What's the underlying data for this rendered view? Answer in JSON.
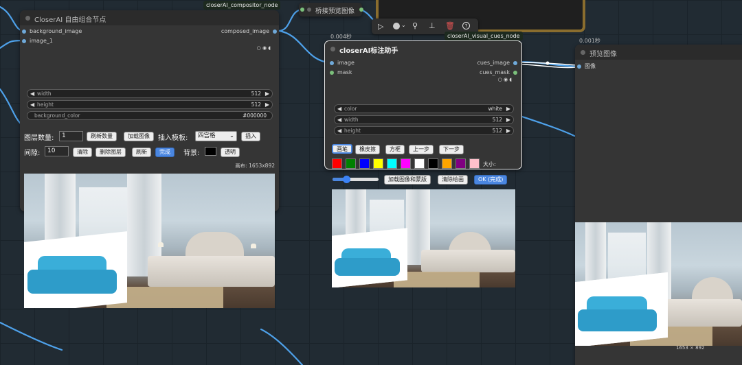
{
  "compositor_node": {
    "tag": "closerAI_compositor_node",
    "title": "CloserAI 自由组合节点",
    "inputs": [
      "background_image",
      "image_1"
    ],
    "output": "composed_image",
    "widgets": {
      "width_label": "width",
      "width_value": "512",
      "height_label": "height",
      "height_value": "512",
      "bgcolor_label": "background_color",
      "bgcolor_value": "#000000"
    },
    "layer_count_label": "图层数量:",
    "layer_count_value": "1",
    "refresh_count": "刷新数量",
    "load_image": "加载图像",
    "template_label": "插入模板:",
    "template_value": "四宫格",
    "insert": "插入",
    "gap_label": "间隙:",
    "gap_value": "10",
    "clear": "清除",
    "delete_layer": "删除图层",
    "refresh": "刷新",
    "done": "完成",
    "background_label": "背景:",
    "transparent": "透明",
    "canvas_info": "画布: 1653x892"
  },
  "bridge_node": {
    "title": "桥接预览图像"
  },
  "cues_node": {
    "tag": "closerAI_visual_cues_node",
    "timing": "0.004秒",
    "title": "closerAI标注助手",
    "inputs": [
      "image",
      "mask"
    ],
    "outputs": [
      "cues_image",
      "cues_mask"
    ],
    "widgets": {
      "color_label": "color",
      "color_value": "white",
      "width_label": "width",
      "width_value": "512",
      "height_label": "height",
      "height_value": "512"
    },
    "tools": [
      "画笔",
      "橡皮擦",
      "方框",
      "上一步",
      "下一步"
    ],
    "palette": [
      "#ff0000",
      "#008000",
      "#0000ff",
      "#ffff00",
      "#00ffff",
      "#ff00ff",
      "#ffffff",
      "#000000",
      "#ffa500",
      "#800080",
      "#ffc0cb"
    ],
    "size_label": "大小:",
    "slider_level": 0.3,
    "load_btn": "加载图像和蒙版",
    "clear_btn": "清除绘画",
    "ok_btn": "OK (完成)"
  },
  "preview_node": {
    "timing": "0.001秒",
    "title": "预览图像",
    "input": "图像",
    "size_text": "1653 × 892"
  },
  "colors": {
    "canvas": "#212b33",
    "node": "#353535",
    "wire": "#4ea1ea",
    "accent": "#4a86e0"
  }
}
